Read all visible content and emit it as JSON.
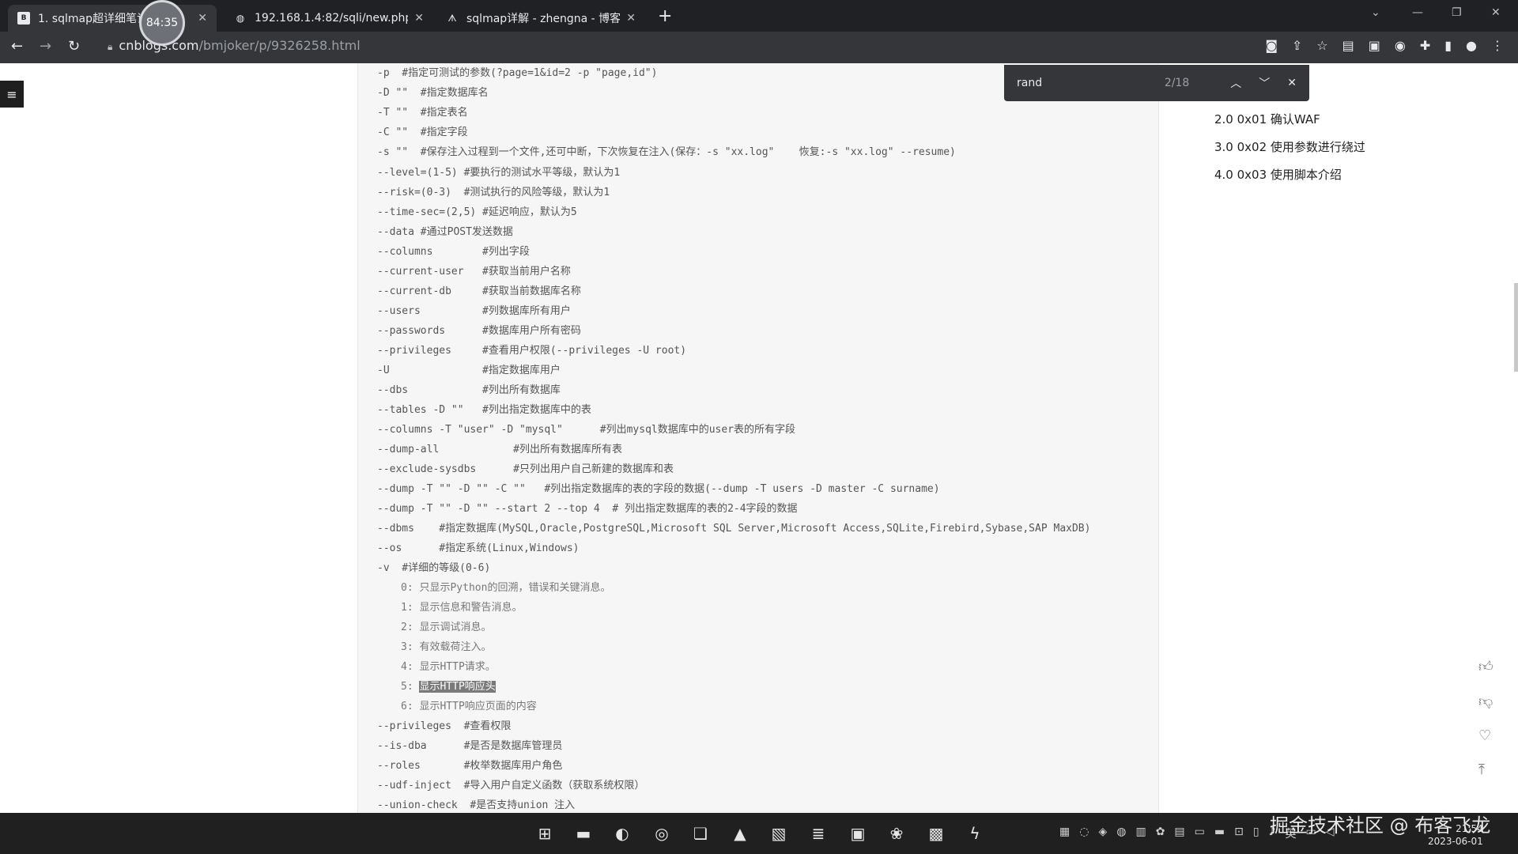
{
  "browser": {
    "timer": "84:35",
    "tabs": [
      {
        "title": "1. sqlmap超详细笔记",
        "active": true
      },
      {
        "title": "192.168.1.4:82/sqli/new.php?",
        "active": false
      },
      {
        "title": "sqlmap详解 - zhengna - 博客园",
        "active": false
      }
    ],
    "url_domain": "cnblogs.com",
    "url_path": "/bmjoker/p/9326258.html",
    "find": {
      "query": "rand",
      "count": "2/18"
    }
  },
  "article": {
    "lines": [
      "-p  #指定可测试的参数(?page=1&id=2 -p \"page,id\")",
      "-D \"\"  #指定数据库名",
      "-T \"\"  #指定表名",
      "-C \"\"  #指定字段",
      "-s \"\"  #保存注入过程到一个文件,还可中断，下次恢复在注入(保存：-s \"xx.log\"    恢复:-s \"xx.log\" --resume)",
      "--level=(1-5) #要执行的测试水平等级，默认为1",
      "--risk=(0-3)  #测试执行的风险等级，默认为1",
      "--time-sec=(2,5) #延迟响应，默认为5",
      "--data #通过POST发送数据",
      "--columns        #列出字段",
      "--current-user   #获取当前用户名称",
      "--current-db     #获取当前数据库名称",
      "--users          #列数据库所有用户",
      "--passwords      #数据库用户所有密码",
      "--privileges     #查看用户权限(--privileges -U root)",
      "-U               #指定数据库用户",
      "--dbs            #列出所有数据库",
      "--tables -D \"\"   #列出指定数据库中的表",
      "--columns -T \"user\" -D \"mysql\"      #列出mysql数据库中的user表的所有字段",
      "--dump-all            #列出所有数据库所有表",
      "--exclude-sysdbs      #只列出用户自己新建的数据库和表",
      "--dump -T \"\" -D \"\" -C \"\"   #列出指定数据库的表的字段的数据(--dump -T users -D master -C surname)",
      "--dump -T \"\" -D \"\" --start 2 --top 4  # 列出指定数据库的表的2-4字段的数据",
      "--dbms    #指定数据库(MySQL,Oracle,PostgreSQL,Microsoft SQL Server,Microsoft Access,SQLite,Firebird,Sybase,SAP MaxDB)",
      "--os      #指定系统(Linux,Windows)",
      "-v  #详细的等级(0-6)"
    ],
    "verbosity": [
      "0: 只显示Python的回溯，错误和关键消息。",
      "1: 显示信息和警告消息。",
      "2: 显示调试消息。",
      "3: 有效载荷注入。",
      "4: 显示HTTP请求。",
      "5: ",
      "6: 显示HTTP响应页面的内容"
    ],
    "highlight": "显示HTTP响应头",
    "lines_after": [
      "--privileges  #查看权限",
      "--is-dba      #是否是数据库管理员",
      "--roles       #枚举数据库用户角色",
      "--udf-inject  #导入用户自定义函数（获取系统权限）",
      "--union-check  #是否支持union 注入"
    ]
  },
  "toc": [
    "2.0  0x01 确认WAF",
    "3.0  0x02 使用参数进行绕过",
    "4.0  0x03 使用脚本介绍"
  ],
  "taskbar": {
    "time": "21:54",
    "date": "2023-06-01",
    "watermark": "掘金技术社区 @ 布客飞龙"
  }
}
